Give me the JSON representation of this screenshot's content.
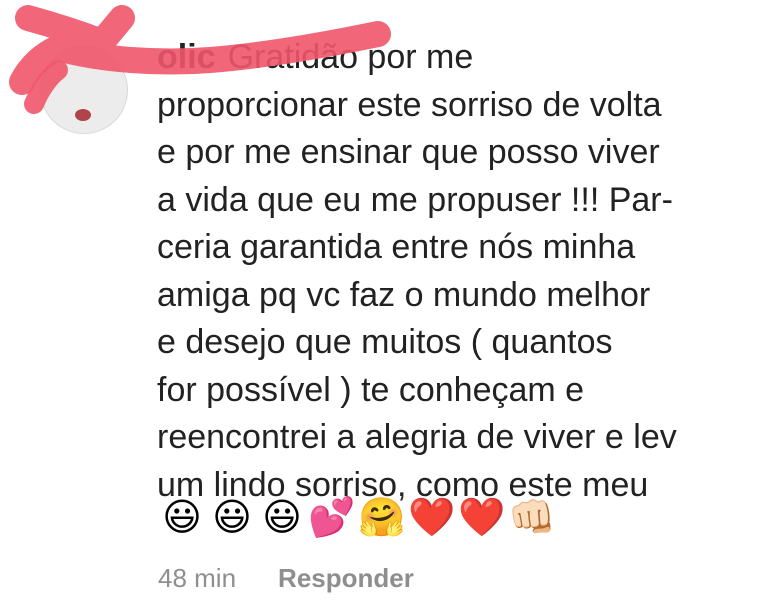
{
  "comment": {
    "username": "olic",
    "lines": [
      "Gratidão por me",
      "proporcionar este sorriso de volta",
      "e por me ensinar que posso viver",
      "a vida que eu me  propuser !!! Par-",
      "ceria garantida entre nós minha",
      "amiga pq vc faz o mundo melhor",
      "e desejo que muitos ( quantos",
      "for possível ) te conheçam e",
      "reencontrei a alegria de viver e lev",
      "um lindo  sorriso, como este meu"
    ],
    "emojis": [
      {
        "name": "grinning-face-icon",
        "glyph": "😃"
      },
      {
        "name": "grinning-face-icon",
        "glyph": "😃"
      },
      {
        "name": "grinning-face-icon",
        "glyph": "😃"
      },
      {
        "name": "two-hearts-icon",
        "glyph": "💕"
      },
      {
        "name": "hugging-face-icon",
        "glyph": "🤗"
      },
      {
        "name": "red-heart-icon",
        "glyph": "❤️"
      },
      {
        "name": "red-heart-icon",
        "glyph": "❤️"
      },
      {
        "name": "fist-bump-icon",
        "glyph": "👊🏻"
      }
    ]
  },
  "meta": {
    "timestamp": "48 min",
    "reply_label": "Responder"
  },
  "colors": {
    "text": "#222222",
    "muted": "#8e8e8e",
    "redaction": "#f0566a"
  }
}
